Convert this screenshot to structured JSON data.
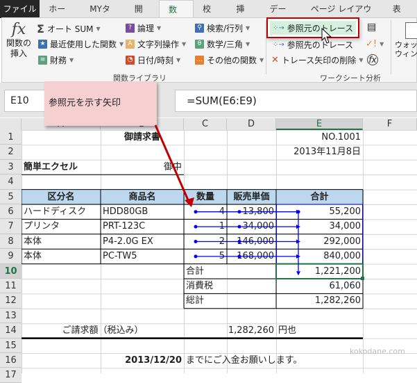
{
  "tabs": [
    "ファイル",
    "ホーム",
    "MYタブ",
    "開発",
    "数式",
    "校閲",
    "挿入",
    "データ",
    "ページ レイアウト",
    "表示"
  ],
  "ribbon": {
    "insert_function": "関数の\n挿入",
    "autosum": "オート SUM",
    "recent": "最近使用した関数",
    "financial": "財務",
    "logical": "論理",
    "text": "文字列操作",
    "datetime": "日付/時刻",
    "lookup": "検索/行列",
    "math": "数学/三角",
    "more": "その他の関数",
    "library_label": "関数ライブラリ",
    "trace_precedents": "参照元のトレース",
    "trace_dependents": "参照先のトレース",
    "remove_arrows": "トレース矢印の削除",
    "audit_label": "ワークシート分析",
    "watch": "ウォッチ\nウィンドウ"
  },
  "formula_bar": {
    "name_box": "E10",
    "formula": "=SUM(E6:E9)",
    "fx": "fx"
  },
  "callout": "参照元を示す矢印",
  "columns": [
    "A",
    "B",
    "C",
    "D",
    "E",
    "F"
  ],
  "rows": [
    "1",
    "2",
    "3",
    "4",
    "5",
    "6",
    "7",
    "8",
    "9",
    "10",
    "11",
    "12",
    "13",
    "14",
    "15",
    "16",
    "17"
  ],
  "sheet": {
    "title": "御請求書",
    "no": "NO.1001",
    "date": "2013年11月8日",
    "client": "簡単エクセル",
    "onchu": "御中",
    "headers": [
      "区分名",
      "商品名",
      "数量",
      "販売単価",
      "合計"
    ],
    "items": [
      [
        "ハードディスク",
        "HDD80GB",
        "4",
        "13,800",
        "55,200"
      ],
      [
        "プリンタ",
        "PRT-123C",
        "1",
        "34,000",
        "34,000"
      ],
      [
        "本体",
        "P4-2.0G EX",
        "2",
        "146,000",
        "292,000"
      ],
      [
        "本体",
        "PC-TW5",
        "5",
        "168,000",
        "840,000"
      ]
    ],
    "subtotal_label": "合計",
    "subtotal": "1,221,200",
    "tax_label": "消費税",
    "tax": "61,060",
    "total_label": "総計",
    "total": "1,282,260",
    "billing_label": "ご請求額（税込み）",
    "billing": "1,282,260",
    "yen": "円也",
    "due_date": "2013/12/20",
    "due_text": "までにご入金お願いします。",
    "watermark": "kokodane.com"
  },
  "colors": {
    "accent": "#217346",
    "trace": "#0000ff",
    "header_fill": "#bdd7ee",
    "callout": "#f6cfd1",
    "arrow": "#c00000"
  }
}
